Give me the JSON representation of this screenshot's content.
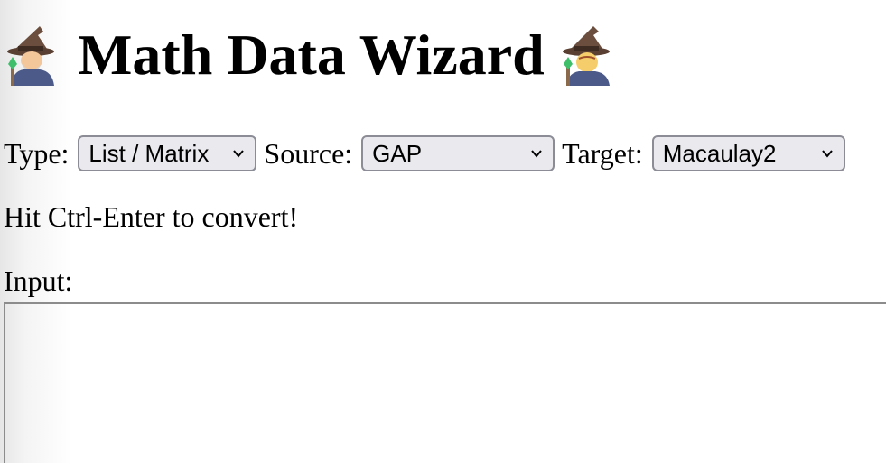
{
  "header": {
    "title": "Math Data Wizard",
    "left_icon": "wizard-emoji-icon",
    "right_icon": "wizard-emoji-icon"
  },
  "controls": {
    "type_label": "Type:",
    "type_value": "List / Matrix",
    "source_label": "Source:",
    "source_value": "GAP",
    "target_label": "Target:",
    "target_value": "Macaulay2"
  },
  "hint": "Hit Ctrl-Enter to convert!",
  "input": {
    "label": "Input:",
    "value": ""
  }
}
